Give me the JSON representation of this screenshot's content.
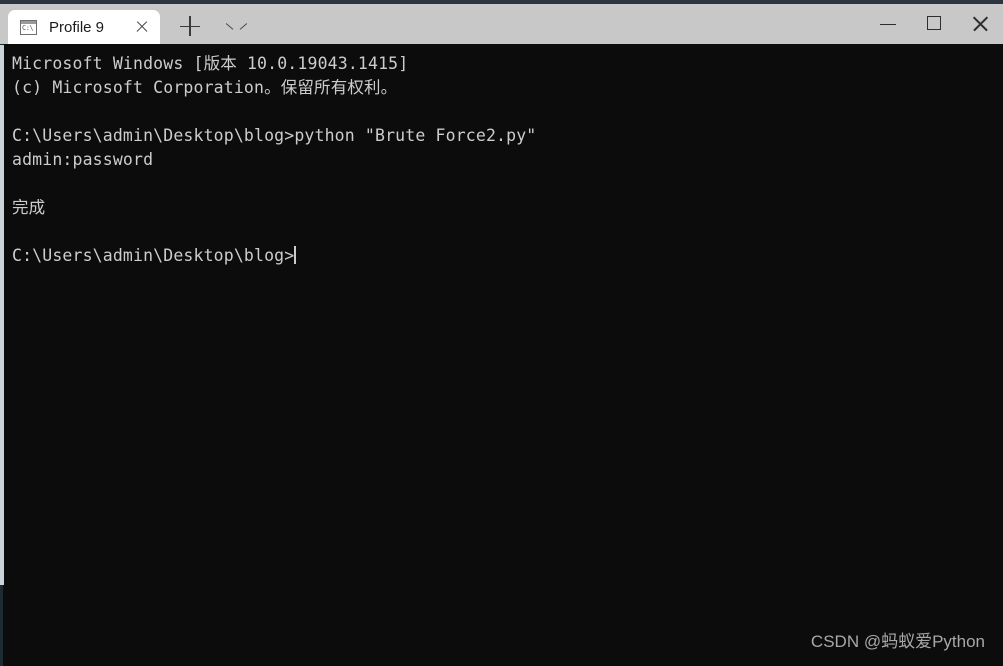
{
  "window": {
    "titlebar_color": "#c8c8c8",
    "top_strip_color": "#2b3440",
    "controls": {
      "minimize_label": "Minimize",
      "maximize_label": "Maximize",
      "close_label": "Close"
    }
  },
  "tabs": {
    "active_index": 0,
    "items": [
      {
        "title": "Profile 9",
        "icon": "console-icon",
        "icon_glyph": "C:\\",
        "close_label": "Close tab"
      }
    ],
    "new_tab_label": "New tab",
    "dropdown_label": "Open new tab dropdown"
  },
  "terminal": {
    "background": "#0c0c0c",
    "foreground": "#cccccc",
    "lines": [
      "Microsoft Windows [版本 10.0.19043.1415]",
      "(c) Microsoft Corporation。保留所有权利。",
      "",
      "C:\\Users\\admin\\Desktop\\blog>python \"Brute Force2.py\"",
      "admin:password",
      "",
      "完成",
      "",
      "C:\\Users\\admin\\Desktop\\blog>"
    ],
    "prompt_line_index": 8,
    "cursor_visible": true
  },
  "watermark": {
    "text": "CSDN @蚂蚁爱Python"
  }
}
